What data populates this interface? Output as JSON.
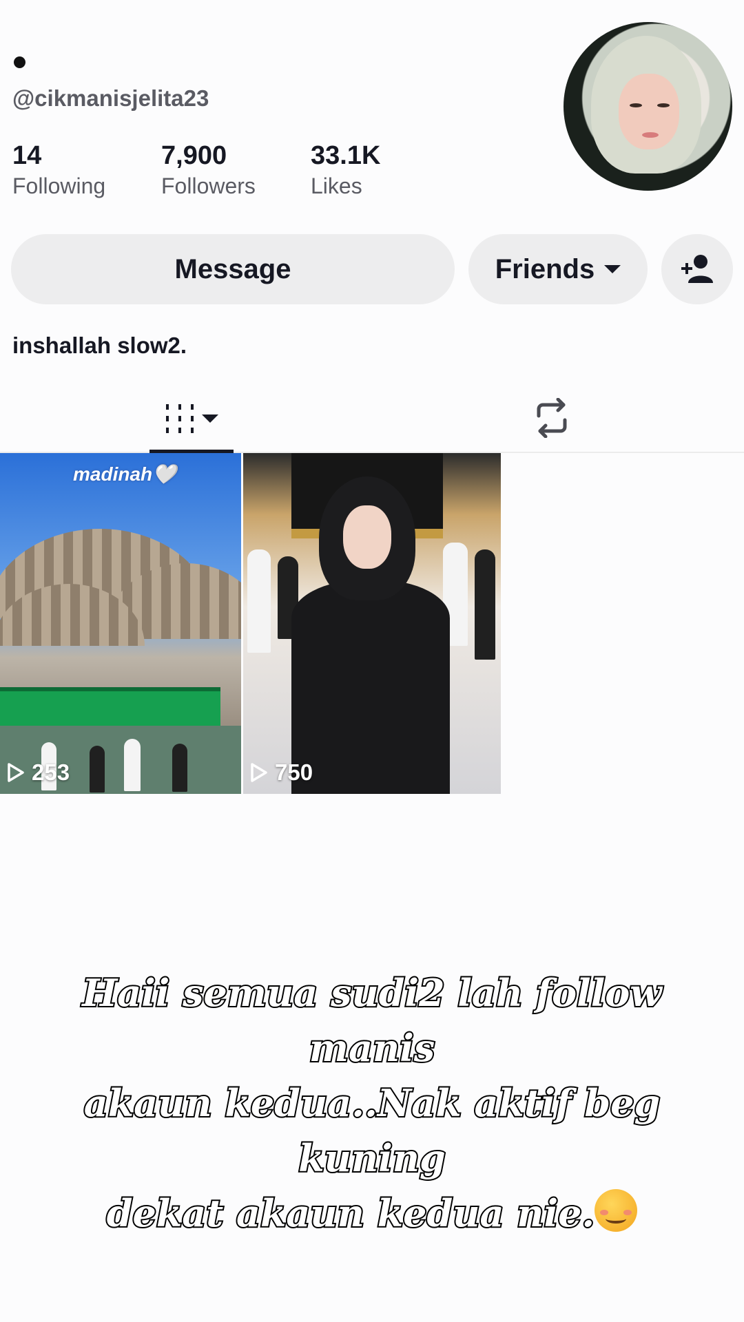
{
  "profile": {
    "handle": "@cikmanisjelita23",
    "bio": "inshallah slow2.",
    "avatar_icon": "profile-photo"
  },
  "stats": [
    {
      "value": "14",
      "label": "Following"
    },
    {
      "value": "7,900",
      "label": "Followers"
    },
    {
      "value": "33.1K",
      "label": "Likes"
    }
  ],
  "actions": {
    "message_label": "Message",
    "friends_label": "Friends",
    "friends_icon": "chevron-down-icon",
    "add_friend_icon": "add-user-icon"
  },
  "tabs": {
    "videos_icon": "grid-icon",
    "repost_icon": "repost-icon"
  },
  "videos": [
    {
      "overlay_text": "madinah🤍",
      "views": "253",
      "play_icon": "play-icon"
    },
    {
      "views": "750",
      "play_icon": "play-icon"
    }
  ],
  "caption": {
    "line1": "Haii semua sudi2 lah follow manis",
    "line2": "akaun kedua..Nak aktif beg kuning",
    "line3": "dekat akaun kedua nie.",
    "emoji": "☺️"
  },
  "colors": {
    "background": "#fcfcfd",
    "text_primary": "#161823",
    "text_secondary": "#5a5b63",
    "button_bg": "#ededee"
  }
}
